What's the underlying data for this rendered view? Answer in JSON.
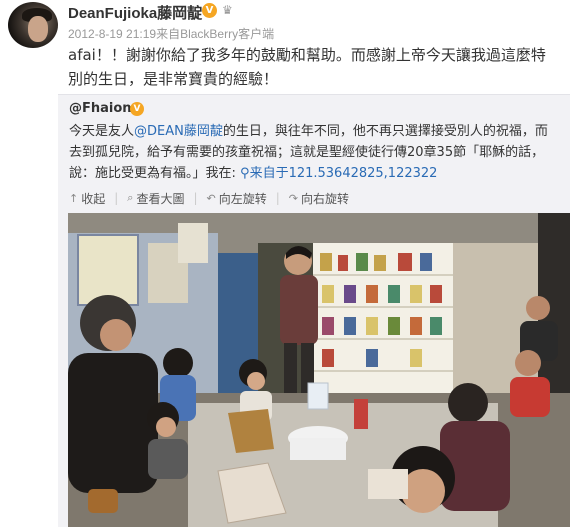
{
  "post": {
    "username": "DeanFujioka藤岡靛",
    "meta": "2012-8-19 21:19来自BlackBerry客户端",
    "text": "afai！！謝謝你給了我多年的鼓勵和幫助。而感謝上帝今天讓我過這麼特別的生日，是非常寶貴的經驗！"
  },
  "repost": {
    "username": "@Fhaione",
    "text_before": "今天是友人",
    "mention": "@DEAN藤岡靛",
    "text_after": "的生日，與往年不同，他不再只選擇接受別人的祝福，而去到孤兒院，給予有需要的孩童祝福；這就是聖經使徒行傳20章35節「耶穌的話，說：施比受更為有福。」我在:",
    "location": "来自于121.53642825,122322"
  },
  "toolbar": {
    "collapse": "收起",
    "view_large": "查看大圖",
    "rotate_left": "向左旋转",
    "rotate_right": "向右旋转"
  },
  "colors": {
    "link": "#2a6bb5",
    "verified": "#f5a623",
    "repost_bg": "#f2f2f5"
  }
}
